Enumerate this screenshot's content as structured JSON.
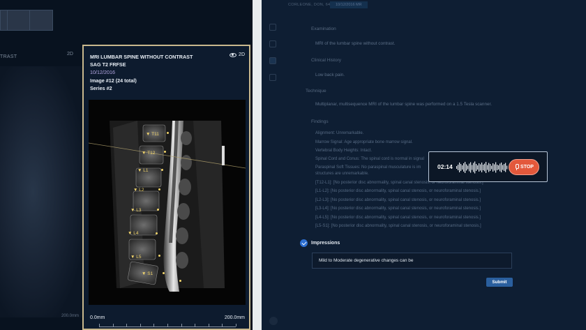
{
  "left_panel": {
    "header_label": "TRAST",
    "view_mode": "2D",
    "scale_end": "200.0mm"
  },
  "viewer": {
    "title": "MRI LUMBAR SPINE WITHOUT CONTRAST",
    "sequence": "SAG T2 FRFSE",
    "date": "10/12/2016",
    "image_label": "Image #12 (24 total)",
    "series_label": "Series #2",
    "view_mode": "2D",
    "scale_start": "0.0mm",
    "scale_end": "200.0mm",
    "vertebrae": [
      "T11",
      "T12",
      "L1",
      "L2",
      "L3",
      "L4",
      "L5",
      "S1"
    ]
  },
  "report": {
    "patient_name": "CORLEONE, DON, 64",
    "patient_date": "10/12/2016 MR",
    "examination_label": "Examination",
    "examination_text": "MRI of the lumbar spine without contrast.",
    "clinical_history_label": "Clinical History",
    "clinical_history_text": "Low back pain.",
    "technique_label": "Technique",
    "technique_text": "Multiplanar, multisequence MRI of the lumbar spine was performed on a 1.5 Tesla scanner.",
    "findings_label": "Findings",
    "findings": [
      "Alignment: Unremarkable.",
      "Marrow Signal: Age appropriate bone marrow signal.",
      "Vertebral Body Heights: Intact.",
      "Spinal Cord and Conus: The spinal cord is normal in signal",
      "Paraspinal Soft Tissues: No paraspinal musculature is im",
      "structures are unremarkable.",
      "[T12-L1]: [No posterior disc abnormality, spinal canal stenosis, or neuroforaminal stenosis.]",
      "[L1-L2]: [No posterior disc abnormality, spinal canal stenosis, or neuroforaminal stenosis.]",
      "[L2-L3]: [No posterior disc abnormality, spinal canal stenosis, or neuroforaminal stenosis.]",
      "[L3-L4]: [No posterior disc abnormality, spinal canal stenosis, or neuroforaminal stenosis.]",
      "[L4-L5]: [No posterior disc abnormality, spinal canal stenosis, or neuroforaminal stenosis.]",
      "[L5-S1]: [No posterior disc abnormality, spinal canal stenosis, or neuroforaminal stenosis.]"
    ],
    "impressions_label": "Impressions",
    "impressions_value": "Mild to Moderate degenerative changes can be",
    "submit_label": "Submit"
  },
  "recorder": {
    "time": "02:14",
    "stop_label": "STOP"
  },
  "colors": {
    "accent": "#2d6fd1",
    "stop": "#e3583b",
    "viewer_border": "#c9b88d",
    "date": "#b7a9e6"
  }
}
